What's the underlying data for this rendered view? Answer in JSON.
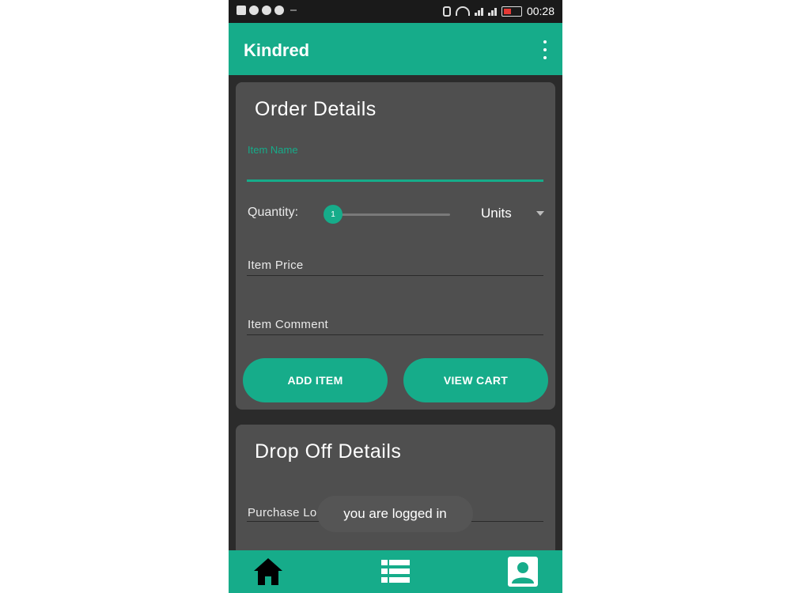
{
  "status_bar": {
    "time": "00:28"
  },
  "app_bar": {
    "title": "Kindred"
  },
  "order_card": {
    "title": "Order Details",
    "item_name_label": "Item Name",
    "quantity_label": "Quantity:",
    "quantity_value": "1",
    "units_value": "Units",
    "item_price_label": "Item Price",
    "item_comment_label": "Item Comment",
    "add_item_label": "ADD ITEM",
    "view_cart_label": "VIEW CART"
  },
  "drop_card": {
    "title": "Drop Off Details",
    "purchase_location_label": "Purchase Loc"
  },
  "toast": {
    "message": "you are logged in"
  },
  "bottom_nav": {
    "items": [
      {
        "icon": "home-icon"
      },
      {
        "icon": "list-icon"
      },
      {
        "icon": "profile-icon"
      }
    ]
  },
  "colors": {
    "primary": "#16ac8a",
    "background": "#2b2b2b",
    "card": "#4f4f4f"
  }
}
